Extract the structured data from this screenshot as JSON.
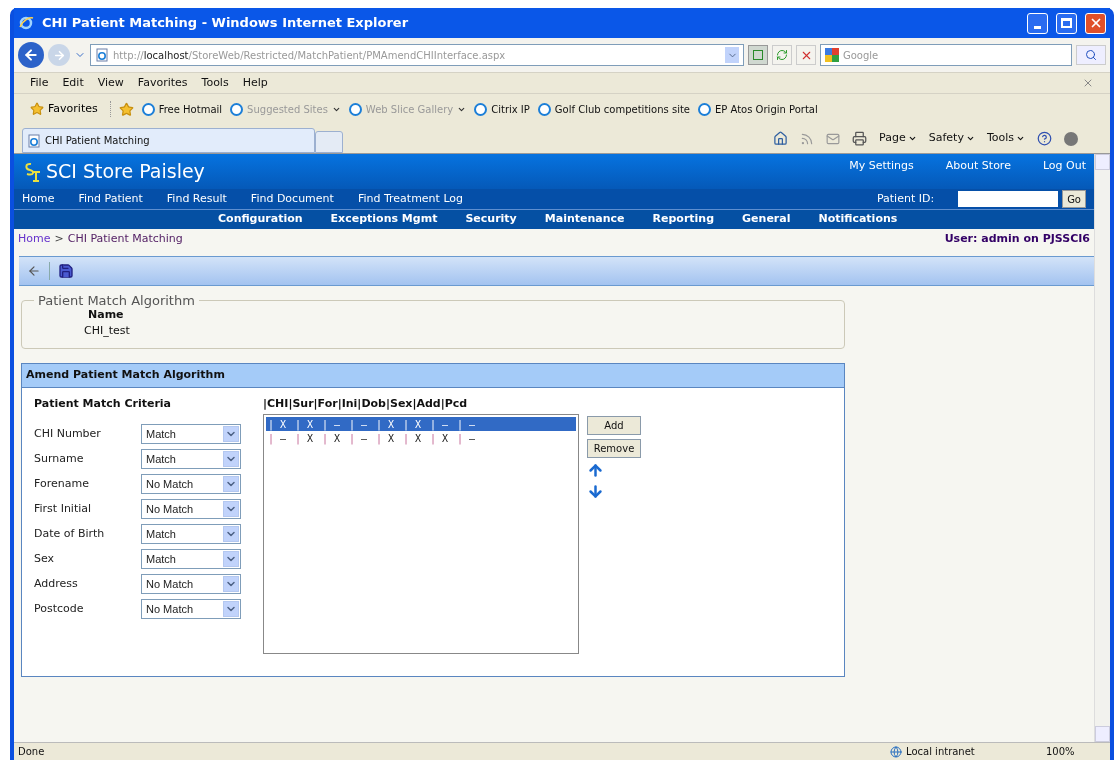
{
  "window": {
    "title": "CHI Patient Matching - Windows Internet Explorer"
  },
  "address_bar": {
    "url_prefix": "http://",
    "url_host": "localhost",
    "url_path": "/StoreWeb/Restricted/MatchPatient/PMAmendCHIInterface.aspx",
    "search_placeholder": "Google"
  },
  "menu_bar": [
    "File",
    "Edit",
    "View",
    "Favorites",
    "Tools",
    "Help"
  ],
  "favorites_bar": {
    "favorites_label": "Favorites",
    "links": [
      {
        "label": "Free Hotmail",
        "dimmed": false,
        "dropdown": false
      },
      {
        "label": "Suggested Sites",
        "dimmed": true,
        "dropdown": true
      },
      {
        "label": "Web Slice Gallery",
        "dimmed": true,
        "dropdown": true
      },
      {
        "label": "Citrix IP",
        "dimmed": false,
        "dropdown": false
      },
      {
        "label": "Golf Club competitions site",
        "dimmed": false,
        "dropdown": false
      },
      {
        "label": "EP Atos Origin Portal",
        "dimmed": false,
        "dropdown": false
      }
    ]
  },
  "tabs": [
    {
      "label": "CHI Patient Matching",
      "selected": true
    }
  ],
  "command_bar": [
    "Page",
    "Safety",
    "Tools"
  ],
  "site": {
    "title": "SCI Store Paisley",
    "top_links": [
      "My Settings",
      "About Store",
      "Log Out"
    ],
    "nav": [
      "Home",
      "Find Patient",
      "Find Result",
      "Find Document",
      "Find Treatment Log"
    ],
    "patient_id_label": "Patient ID:",
    "go_button": "Go",
    "menu": [
      "Configuration",
      "Exceptions Mgmt",
      "Security",
      "Maintenance",
      "Reporting",
      "General",
      "Notifications"
    ]
  },
  "breadcrumb": [
    "Home",
    ">",
    "CHI Patient Matching"
  ],
  "user": "User: admin on PJSSCI6",
  "algorithm": {
    "legend": "Patient Match Algorithm",
    "name_header": "Name",
    "name_value": "CHI_test"
  },
  "amend_panel": {
    "title": "Amend Patient Match Algorithm",
    "criteria_title": "Patient Match Criteria",
    "criteria": [
      {
        "label": "CHI Number",
        "value": "Match"
      },
      {
        "label": "Surname",
        "value": "Match"
      },
      {
        "label": "Forename",
        "value": "No Match"
      },
      {
        "label": "First Initial",
        "value": "No Match"
      },
      {
        "label": "Date of Birth",
        "value": "Match"
      },
      {
        "label": "Sex",
        "value": "Match"
      },
      {
        "label": "Address",
        "value": "No Match"
      },
      {
        "label": "Postcode",
        "value": "No Match"
      }
    ],
    "list_header": "|CHI|Sur|For|Ini|Dob|Sex|Add|Pcd",
    "rows": [
      {
        "separator": "|",
        "cells": [
          "X",
          "X",
          "–",
          "–",
          "X",
          "X",
          "–",
          "–"
        ],
        "selected": true
      },
      {
        "separator": "|",
        "cells": [
          "–",
          "X",
          "X",
          "–",
          "X",
          "X",
          "X",
          "–"
        ],
        "selected": false
      }
    ],
    "buttons": [
      "Add",
      "Remove"
    ]
  },
  "status_bar": {
    "text": "Done",
    "zone": "Local intranet",
    "zoom": "100%"
  }
}
